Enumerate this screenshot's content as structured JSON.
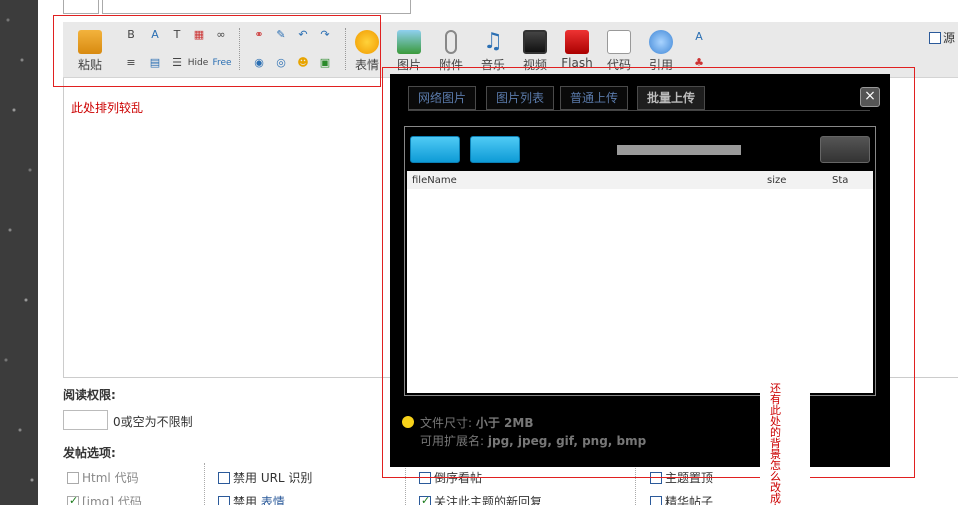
{
  "toolbar": {
    "paste_label": "粘贴",
    "emoticon_label": "表情",
    "image_label": "图片",
    "attachment_label": "附件",
    "music_label": "音乐",
    "video_label": "视频",
    "flash_label": "Flash",
    "code_label": "代码",
    "quote_label": "引用",
    "hide_label": "Hide",
    "free_label": "Free",
    "source_label": "源"
  },
  "annotations": {
    "layout_note": "此处排列较乱",
    "background_note": "还有此处的背景怎么改成白色？"
  },
  "dialog": {
    "tabs": [
      "网络图片",
      "图片列表",
      "普通上传",
      "批量上传"
    ],
    "active_tab": "批量上传",
    "close_symbol": "×",
    "file_columns": [
      "fileName",
      "size",
      "Sta"
    ],
    "size_prefix": "文件尺寸:",
    "size_value": "小于 2MB",
    "ext_prefix": "可用扩展名:",
    "ext_value": "jpg, jpeg, gif, png, bmp"
  },
  "options": {
    "read_permission_label": "阅读权限:",
    "read_permission_hint": "0或空为不限制",
    "post_options_label": "发帖选项:",
    "html_code": "Html 代码",
    "img_code": "[img] 代码",
    "disable_url": "禁用 URL 识别",
    "disable_prefix": "禁用",
    "disable_emoticon_link": "表情",
    "reverse_view": "倒序看帖",
    "follow_replies": "关注此主题的新回复",
    "sticky_topic": "主题置顶",
    "digest_post": "精华帖子"
  },
  "colors": {
    "annotation_red": "#cc0000",
    "dialog_bg": "#000000",
    "upload_button": "#1aaae6"
  }
}
